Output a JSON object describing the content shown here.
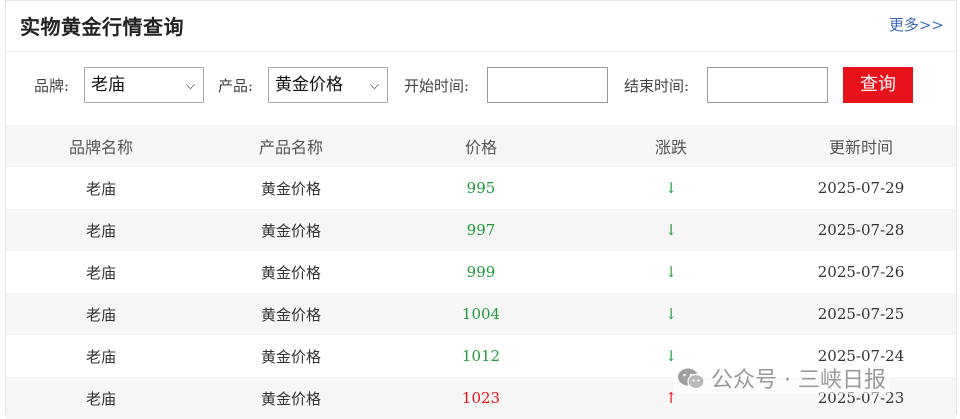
{
  "header": {
    "title": "实物黄金行情查询",
    "more": "更多>>"
  },
  "filters": {
    "brand_label": "品牌:",
    "brand_value": "老庙",
    "product_label": "产品:",
    "product_value": "黄金价格",
    "start_label": "开始时间:",
    "end_label": "结束时间:",
    "query_button": "查询"
  },
  "table": {
    "columns": [
      "品牌名称",
      "产品名称",
      "价格",
      "涨跌",
      "更新时间"
    ],
    "rows": [
      {
        "brand": "老庙",
        "product": "黄金价格",
        "price": "995",
        "trend": "↓",
        "direction": "down",
        "date": "2025-07-29"
      },
      {
        "brand": "老庙",
        "product": "黄金价格",
        "price": "997",
        "trend": "↓",
        "direction": "down",
        "date": "2025-07-28"
      },
      {
        "brand": "老庙",
        "product": "黄金价格",
        "price": "999",
        "trend": "↓",
        "direction": "down",
        "date": "2025-07-26"
      },
      {
        "brand": "老庙",
        "product": "黄金价格",
        "price": "1004",
        "trend": "↓",
        "direction": "down",
        "date": "2025-07-25"
      },
      {
        "brand": "老庙",
        "product": "黄金价格",
        "price": "1012",
        "trend": "↓",
        "direction": "down",
        "date": "2025-07-24"
      },
      {
        "brand": "老庙",
        "product": "黄金价格",
        "price": "1023",
        "trend": "↑",
        "direction": "up",
        "date": "2025-07-23"
      }
    ]
  },
  "colors": {
    "accent_red": "#e8121a",
    "down_green": "#1f9a3a",
    "link_blue": "#3b6bb5"
  },
  "watermark": {
    "text": "公众号 · 三峡日报",
    "icon": "wechat-icon"
  }
}
